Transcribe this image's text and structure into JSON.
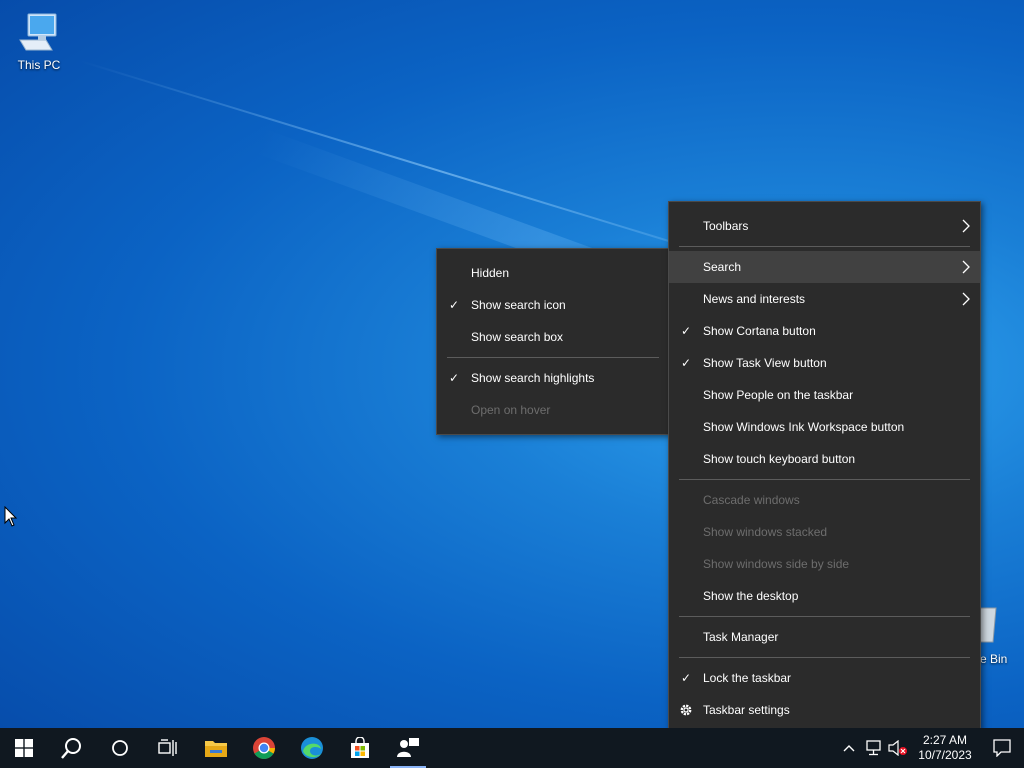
{
  "desktop": {
    "icons": [
      {
        "label": "This PC"
      },
      {
        "label": "e Bin"
      }
    ]
  },
  "search_submenu": {
    "items": [
      {
        "label": "Hidden",
        "checked": false,
        "enabled": true
      },
      {
        "label": "Show search icon",
        "checked": true,
        "enabled": true
      },
      {
        "label": "Show search box",
        "checked": false,
        "enabled": true
      },
      {
        "label": "Show search highlights",
        "checked": true,
        "enabled": true
      },
      {
        "label": "Open on hover",
        "checked": false,
        "enabled": false
      }
    ]
  },
  "taskbar_menu": {
    "items": [
      {
        "label": "Toolbars"
      },
      {
        "label": "Search"
      },
      {
        "label": "News and interests"
      },
      {
        "label": "Show Cortana button"
      },
      {
        "label": "Show Task View button"
      },
      {
        "label": "Show People on the taskbar"
      },
      {
        "label": "Show Windows Ink Workspace button"
      },
      {
        "label": "Show touch keyboard button"
      },
      {
        "label": "Cascade windows"
      },
      {
        "label": "Show windows stacked"
      },
      {
        "label": "Show windows side by side"
      },
      {
        "label": "Show the desktop"
      },
      {
        "label": "Task Manager"
      },
      {
        "label": "Lock the taskbar"
      },
      {
        "label": "Taskbar settings"
      }
    ]
  },
  "taskbar": {
    "apps": [
      "start-icon",
      "search-icon",
      "cortana-icon",
      "task-view-icon",
      "file-explorer-icon",
      "chrome-icon",
      "edge-icon",
      "store-icon",
      "people-icon"
    ],
    "clock": {
      "time": "2:27 AM",
      "date": "10/7/2023"
    }
  },
  "colors": {
    "menu_bg": "#2b2b2b",
    "menu_highlight": "#414141",
    "disabled_text": "#6d6d6d",
    "taskbar_bg": "#101820"
  }
}
